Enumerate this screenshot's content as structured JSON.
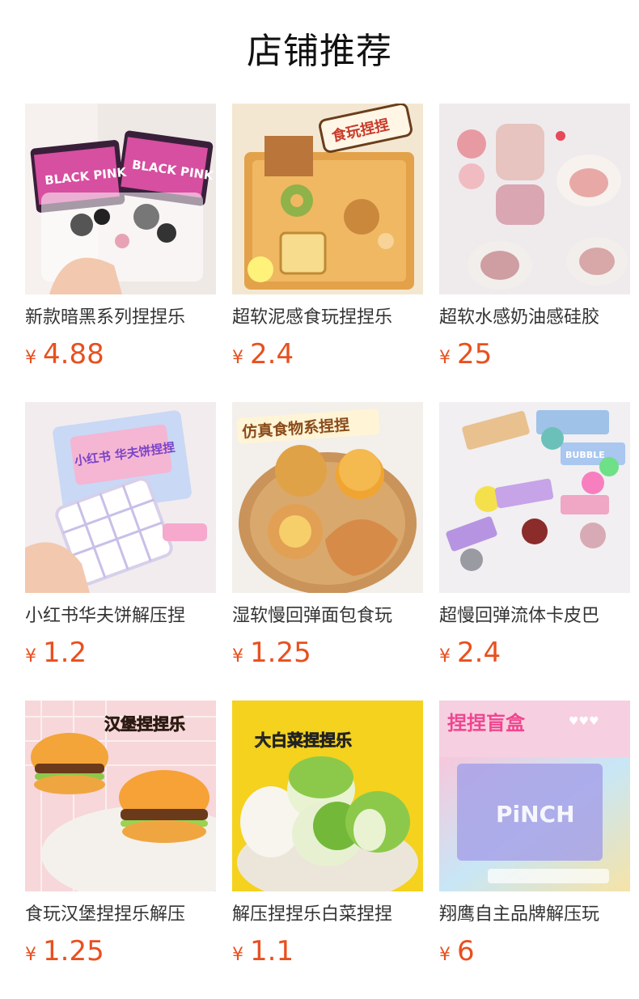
{
  "section_title": "店铺推荐",
  "currency": "¥",
  "products": [
    {
      "name": "新款暗黑系列捏捏乐",
      "price": "4.88",
      "image": "squeeze-toy-photo",
      "overlay": "BLACK PINK"
    },
    {
      "name": "超软泥感食玩捏捏乐",
      "price": "2.4",
      "image": "squeeze-toy-photo",
      "overlay": "食玩捏捏"
    },
    {
      "name": "超软水感奶油感硅胶",
      "price": "25",
      "image": "squeeze-toy-photo",
      "overlay": ""
    },
    {
      "name": "小红书华夫饼解压捏",
      "price": "1.2",
      "image": "squeeze-toy-photo",
      "overlay": "小红书 华夫饼捏捏"
    },
    {
      "name": "湿软慢回弹面包食玩",
      "price": "1.25",
      "image": "squeeze-toy-photo",
      "overlay": "仿真食物系捏捏"
    },
    {
      "name": "超慢回弹流体卡皮巴",
      "price": "2.4",
      "image": "squeeze-toy-photo",
      "overlay": "BUBBLE"
    },
    {
      "name": "食玩汉堡捏捏乐解压",
      "price": "1.25",
      "image": "squeeze-toy-photo",
      "overlay": "汉堡捏捏乐"
    },
    {
      "name": "解压捏捏乐白菜捏捏",
      "price": "1.1",
      "image": "squeeze-toy-photo",
      "overlay": "大白菜捏捏乐"
    },
    {
      "name": "翔鹰自主品牌解压玩",
      "price": "6",
      "image": "squeeze-toy-photo",
      "overlay": "捏捏盲盒"
    }
  ]
}
